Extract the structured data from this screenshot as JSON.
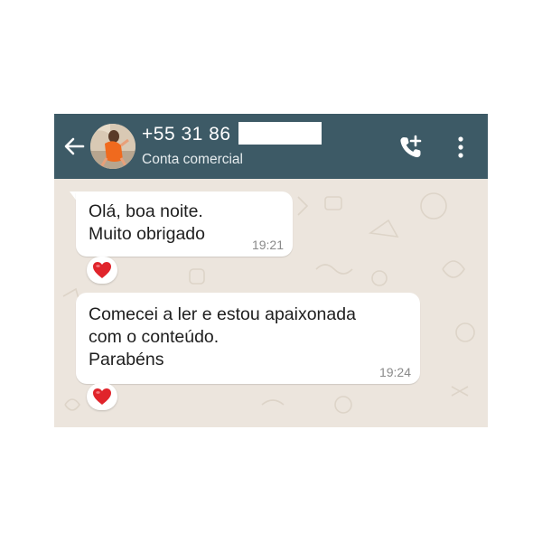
{
  "header": {
    "contact_name": "+55 31 86",
    "contact_subtitle": "Conta comercial",
    "background_color": "#3d5a66"
  },
  "messages": [
    {
      "text": "Olá, boa noite.\nMuito obrigado",
      "time": "19:21",
      "reaction": "heart"
    },
    {
      "text": "Comecei a ler e estou apaixonada\ncom o conteúdo.\nParabéns",
      "time": "19:24",
      "reaction": "heart"
    }
  ],
  "icons": {
    "back": "arrow-left-icon",
    "add_call": "add-call-icon",
    "menu": "more-vertical-icon",
    "reaction": "red-heart-icon"
  },
  "colors": {
    "chat_background": "#ece5dd",
    "bubble": "#ffffff",
    "heart": "#e0242b"
  }
}
